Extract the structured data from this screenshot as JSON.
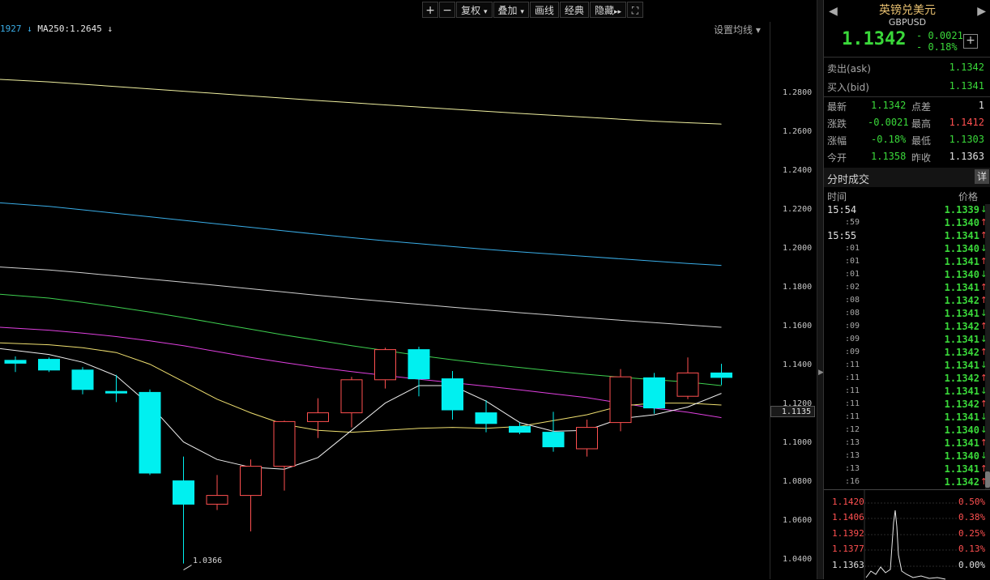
{
  "toolbar": {
    "plus_label": "+",
    "minus_label": "−",
    "adjust_label": "复权",
    "overlay_label": "叠加",
    "draw_label": "画线",
    "classic_label": "经典",
    "hide_label": "隐藏",
    "adjust_arrow": "▾",
    "overlay_arrow": "▾",
    "hide_arrow": "▸▸",
    "fullscreen_icon": "⛶"
  },
  "legend": {
    "ma1_text": "1927 ↓",
    "ma250_text": "MA250:1.2645 ↓",
    "settings_label": "设置均线 ▾"
  },
  "axis": {
    "ticks": [
      "1.2800",
      "1.2600",
      "1.2400",
      "1.2200",
      "1.2000",
      "1.1800",
      "1.1600",
      "1.1400",
      "1.1200",
      "1.1000",
      "1.0800",
      "1.0600",
      "1.0400"
    ],
    "current_price": "1.1135",
    "low_label": "1.0366"
  },
  "chart_data": {
    "type": "candlestick",
    "ylim": [
      1.03,
      1.305
    ],
    "candles": [
      {
        "o": 1.143,
        "h": 1.145,
        "l": 1.137,
        "c": 1.1415
      },
      {
        "o": 1.1435,
        "h": 1.1445,
        "l": 1.137,
        "c": 1.138
      },
      {
        "o": 1.138,
        "h": 1.1395,
        "l": 1.1255,
        "c": 1.128
      },
      {
        "o": 1.127,
        "h": 1.1355,
        "l": 1.1215,
        "c": 1.1265
      },
      {
        "o": 1.1265,
        "h": 1.128,
        "l": 1.084,
        "c": 1.085
      },
      {
        "o": 1.081,
        "h": 1.0935,
        "l": 1.0385,
        "c": 1.069
      },
      {
        "o": 1.069,
        "h": 1.084,
        "l": 1.066,
        "c": 1.0735
      },
      {
        "o": 1.0735,
        "h": 1.092,
        "l": 1.055,
        "c": 1.0885
      },
      {
        "o": 1.0885,
        "h": 1.112,
        "l": 1.076,
        "c": 1.1115
      },
      {
        "o": 1.1115,
        "h": 1.1235,
        "l": 1.103,
        "c": 1.116
      },
      {
        "o": 1.116,
        "h": 1.1345,
        "l": 1.1085,
        "c": 1.133
      },
      {
        "o": 1.133,
        "h": 1.1495,
        "l": 1.1285,
        "c": 1.1485
      },
      {
        "o": 1.1485,
        "h": 1.15,
        "l": 1.1245,
        "c": 1.1335
      },
      {
        "o": 1.1335,
        "h": 1.1375,
        "l": 1.1125,
        "c": 1.1175
      },
      {
        "o": 1.116,
        "h": 1.1225,
        "l": 1.106,
        "c": 1.1105
      },
      {
        "o": 1.109,
        "h": 1.111,
        "l": 1.105,
        "c": 1.106
      },
      {
        "o": 1.106,
        "h": 1.1165,
        "l": 1.096,
        "c": 1.0985
      },
      {
        "o": 1.0975,
        "h": 1.1125,
        "l": 1.0935,
        "c": 1.1085
      },
      {
        "o": 1.111,
        "h": 1.1385,
        "l": 1.1065,
        "c": 1.1345
      },
      {
        "o": 1.134,
        "h": 1.1365,
        "l": 1.1155,
        "c": 1.1185
      },
      {
        "o": 1.1245,
        "h": 1.1445,
        "l": 1.123,
        "c": 1.1365
      },
      {
        "o": 1.1365,
        "h": 1.1412,
        "l": 1.1303,
        "c": 1.1342
      }
    ],
    "series": [
      {
        "color": "#f0f0a0",
        "values": [
          1.2875,
          1.2862,
          1.285,
          1.2838,
          1.2826,
          1.2814,
          1.2802,
          1.279,
          1.2778,
          1.2766,
          1.2755,
          1.2744,
          1.2733,
          1.2722,
          1.2711,
          1.27,
          1.269,
          1.268,
          1.267,
          1.266,
          1.2652,
          1.2645
        ]
      },
      {
        "color": "#3aaee8",
        "values": [
          1.224,
          1.2222,
          1.2204,
          1.2186,
          1.2168,
          1.215,
          1.2132,
          1.2114,
          1.2096,
          1.2078,
          1.2061,
          1.2045,
          1.203,
          1.2015,
          1.2001,
          1.1988,
          1.1976,
          1.1964,
          1.1952,
          1.194,
          1.1928,
          1.1918
        ]
      },
      {
        "color": "#d0d0d0",
        "values": [
          1.191,
          1.1895,
          1.188,
          1.1864,
          1.1848,
          1.1832,
          1.1815,
          1.1798,
          1.1781,
          1.1764,
          1.1748,
          1.1733,
          1.1718,
          1.1703,
          1.1689,
          1.1675,
          1.1662,
          1.1649,
          1.1636,
          1.1624,
          1.1612,
          1.16
        ]
      },
      {
        "color": "#3ed050",
        "values": [
          1.177,
          1.175,
          1.1728,
          1.1704,
          1.1678,
          1.165,
          1.162,
          1.159,
          1.156,
          1.1533,
          1.1505,
          1.148,
          1.1455,
          1.1433,
          1.1412,
          1.1393,
          1.1375,
          1.1358,
          1.1343,
          1.133,
          1.1318,
          1.13
        ]
      },
      {
        "color": "#e040e0",
        "values": [
          1.16,
          1.1585,
          1.157,
          1.1552,
          1.153,
          1.1505,
          1.1475,
          1.1445,
          1.1418,
          1.1393,
          1.1372,
          1.1352,
          1.1333,
          1.1315,
          1.1297,
          1.1278,
          1.1258,
          1.1238,
          1.121,
          1.1184,
          1.1163,
          1.1135
        ]
      },
      {
        "color": "#f0e070",
        "values": [
          1.152,
          1.151,
          1.1495,
          1.147,
          1.141,
          1.132,
          1.123,
          1.116,
          1.11,
          1.107,
          1.106,
          1.107,
          1.108,
          1.1085,
          1.108,
          1.109,
          1.112,
          1.115,
          1.1195,
          1.121,
          1.121,
          1.12
        ]
      },
      {
        "color": "#f0f0f0",
        "values": [
          1.149,
          1.146,
          1.142,
          1.135,
          1.12,
          1.101,
          1.092,
          1.088,
          1.087,
          1.093,
          1.107,
          1.121,
          1.13,
          1.13,
          1.122,
          1.111,
          1.1065,
          1.107,
          1.113,
          1.115,
          1.119,
          1.126
        ]
      }
    ]
  },
  "panel": {
    "back_icon": "◀",
    "forward_icon": "▶",
    "name": "英镑兑美元",
    "code": "GBPUSD",
    "price": "1.1342",
    "change": "- 0.0021",
    "change_pct": "- 0.18%",
    "plus_label": "+",
    "ask_label": "卖出(ask)",
    "ask_value": "1.1342",
    "bid_label": "买入(bid)",
    "bid_value": "1.1341",
    "stats": {
      "latest_label": "最新",
      "latest_value": "1.1342",
      "spread_label": "点差",
      "spread_value": "1",
      "change_label": "涨跌",
      "change_value": "-0.0021",
      "high_label": "最高",
      "high_value": "1.1412",
      "pct_label": "涨幅",
      "pct_value": "-0.18%",
      "low_label": "最低",
      "low_value": "1.1303",
      "open_label": "今开",
      "open_value": "1.1358",
      "prev_label": "昨收",
      "prev_value": "1.1363"
    },
    "trades_title": "分时成交",
    "trades_detail": "详",
    "trades_time_header": "时间",
    "trades_price_header": "价格",
    "trades": [
      {
        "time": "15:54",
        "price": "1.1339",
        "dir": "↓",
        "big": true
      },
      {
        "time": ":59",
        "price": "1.1340",
        "dir": "↑",
        "big": false
      },
      {
        "time": "15:55",
        "price": "1.1341",
        "dir": "↑",
        "big": true
      },
      {
        "time": ":01",
        "price": "1.1340",
        "dir": "↓",
        "big": false
      },
      {
        "time": ":01",
        "price": "1.1341",
        "dir": "↑",
        "big": false
      },
      {
        "time": ":01",
        "price": "1.1340",
        "dir": "↓",
        "big": false
      },
      {
        "time": ":02",
        "price": "1.1341",
        "dir": "↑",
        "big": false
      },
      {
        "time": ":08",
        "price": "1.1342",
        "dir": "↑",
        "big": false
      },
      {
        "time": ":08",
        "price": "1.1341",
        "dir": "↓",
        "big": false
      },
      {
        "time": ":09",
        "price": "1.1342",
        "dir": "↑",
        "big": false
      },
      {
        "time": ":09",
        "price": "1.1341",
        "dir": "↓",
        "big": false
      },
      {
        "time": ":09",
        "price": "1.1342",
        "dir": "↑",
        "big": false
      },
      {
        "time": ":11",
        "price": "1.1341",
        "dir": "↓",
        "big": false
      },
      {
        "time": ":11",
        "price": "1.1342",
        "dir": "↑",
        "big": false
      },
      {
        "time": ":11",
        "price": "1.1341",
        "dir": "↓",
        "big": false
      },
      {
        "time": ":11",
        "price": "1.1342",
        "dir": "↑",
        "big": false
      },
      {
        "time": ":11",
        "price": "1.1341",
        "dir": "↓",
        "big": false
      },
      {
        "time": ":12",
        "price": "1.1340",
        "dir": "↓",
        "big": false
      },
      {
        "time": ":13",
        "price": "1.1341",
        "dir": "↑",
        "big": false
      },
      {
        "time": ":13",
        "price": "1.1340",
        "dir": "↓",
        "big": false
      },
      {
        "time": ":13",
        "price": "1.1341",
        "dir": "↑",
        "big": false
      },
      {
        "time": ":16",
        "price": "1.1342",
        "dir": "↑",
        "big": false
      }
    ],
    "mini": {
      "prices": [
        "1.1420",
        "1.1406",
        "1.1392",
        "1.1377",
        "1.1363"
      ],
      "pcts": [
        "0.50%",
        "0.38%",
        "0.25%",
        "0.13%",
        "0.00%"
      ]
    }
  },
  "colors": {
    "up": "#ff5050",
    "down": "#00f0f0",
    "green": "#3ad83a"
  }
}
